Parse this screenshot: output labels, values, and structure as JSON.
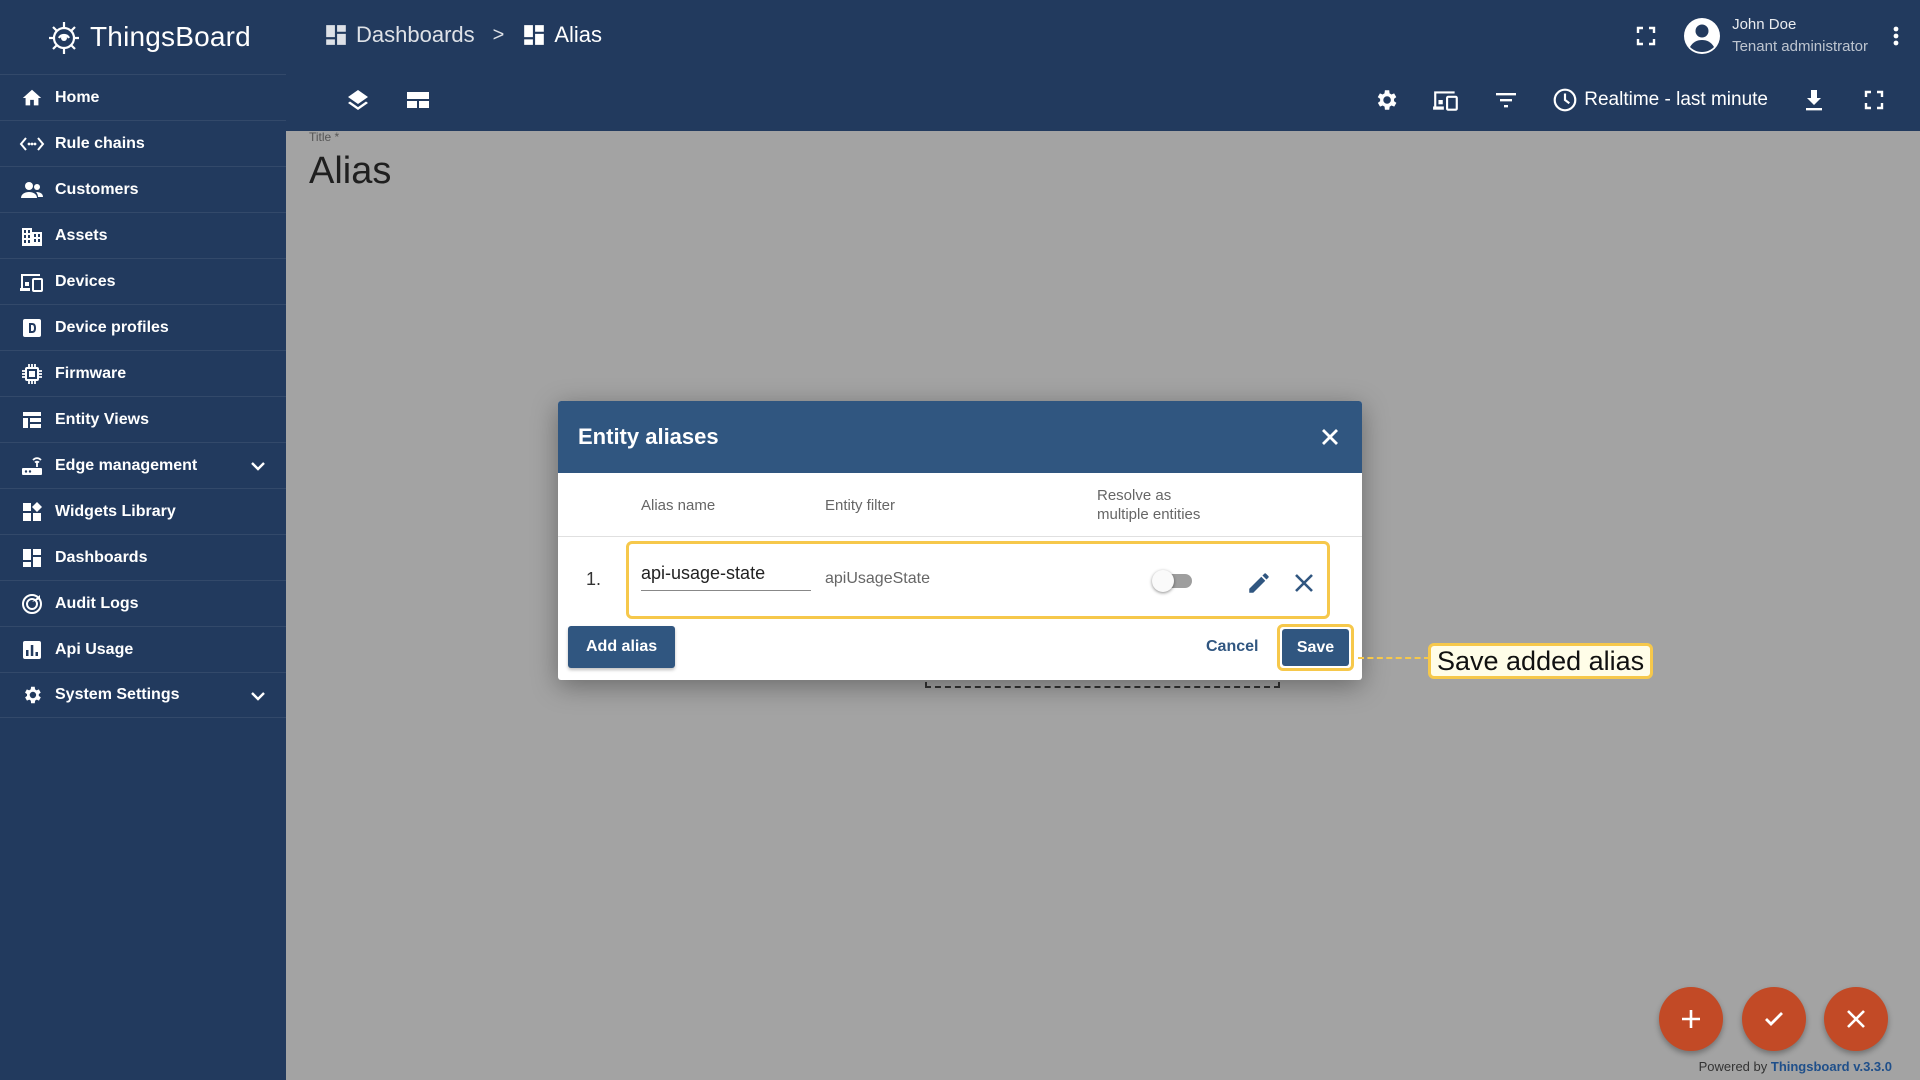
{
  "app": {
    "name": "ThingsBoard"
  },
  "sidebar": {
    "items": [
      {
        "label": "Home",
        "icon": "home-icon"
      },
      {
        "label": "Rule chains",
        "icon": "rule-chains-icon"
      },
      {
        "label": "Customers",
        "icon": "customers-icon"
      },
      {
        "label": "Assets",
        "icon": "assets-icon"
      },
      {
        "label": "Devices",
        "icon": "devices-icon"
      },
      {
        "label": "Device profiles",
        "icon": "device-profiles-icon"
      },
      {
        "label": "Firmware",
        "icon": "firmware-icon"
      },
      {
        "label": "Entity Views",
        "icon": "entity-views-icon"
      },
      {
        "label": "Edge management",
        "icon": "edge-icon",
        "expandable": true
      },
      {
        "label": "Widgets Library",
        "icon": "widgets-icon"
      },
      {
        "label": "Dashboards",
        "icon": "dashboards-icon"
      },
      {
        "label": "Audit Logs",
        "icon": "audit-logs-icon"
      },
      {
        "label": "Api Usage",
        "icon": "api-usage-icon"
      },
      {
        "label": "System Settings",
        "icon": "settings-icon",
        "expandable": true
      }
    ]
  },
  "header": {
    "breadcrumb": [
      "Dashboards",
      "Alias"
    ],
    "breadcrumb_separator": ">",
    "user": {
      "name": "John Doe",
      "role": "Tenant administrator"
    },
    "timewindow_label": "Realtime - last minute"
  },
  "dashboard": {
    "title_label": "Title *",
    "title": "Alias"
  },
  "dialog": {
    "title": "Entity aliases",
    "columns": {
      "alias_name": "Alias name",
      "entity_filter": "Entity filter",
      "resolve_line1": "Resolve as",
      "resolve_line2": "multiple entities"
    },
    "rows": [
      {
        "index": "1.",
        "alias_name": "api-usage-state",
        "entity_filter": "apiUsageState",
        "resolve_multiple": false
      }
    ],
    "add_label": "Add alias",
    "cancel_label": "Cancel",
    "save_label": "Save"
  },
  "annotation": {
    "text": "Save added alias"
  },
  "footer": {
    "powered_prefix": "Powered by",
    "powered_link": "Thingsboard v.3.3.0"
  },
  "colors": {
    "sidebar_bg": "#223a5e",
    "dialog_header": "#305680",
    "highlight": "#f6c84b",
    "fab": "#c24a26"
  }
}
